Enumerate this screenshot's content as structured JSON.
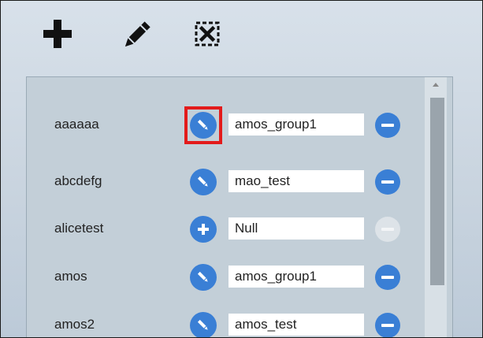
{
  "toolbar": {
    "add_icon": "plus-icon",
    "edit_icon": "pencil-icon",
    "delete_icon": "close-box-icon"
  },
  "users": [
    {
      "name": "aaaaaa",
      "action": "edit",
      "group": "amos_group1",
      "removable": true,
      "highlighted": true
    },
    {
      "name": "abcdefg",
      "action": "edit",
      "group": "mao_test",
      "removable": true,
      "highlighted": false
    },
    {
      "name": "alicetest",
      "action": "add",
      "group": "Null",
      "removable": false,
      "highlighted": false
    },
    {
      "name": "amos",
      "action": "edit",
      "group": "amos_group1",
      "removable": true,
      "highlighted": false
    },
    {
      "name": "amos2",
      "action": "edit",
      "group": "amos_test",
      "removable": true,
      "highlighted": false
    }
  ],
  "colors": {
    "accent": "#3a7fd5",
    "highlight": "#e31b1b"
  }
}
